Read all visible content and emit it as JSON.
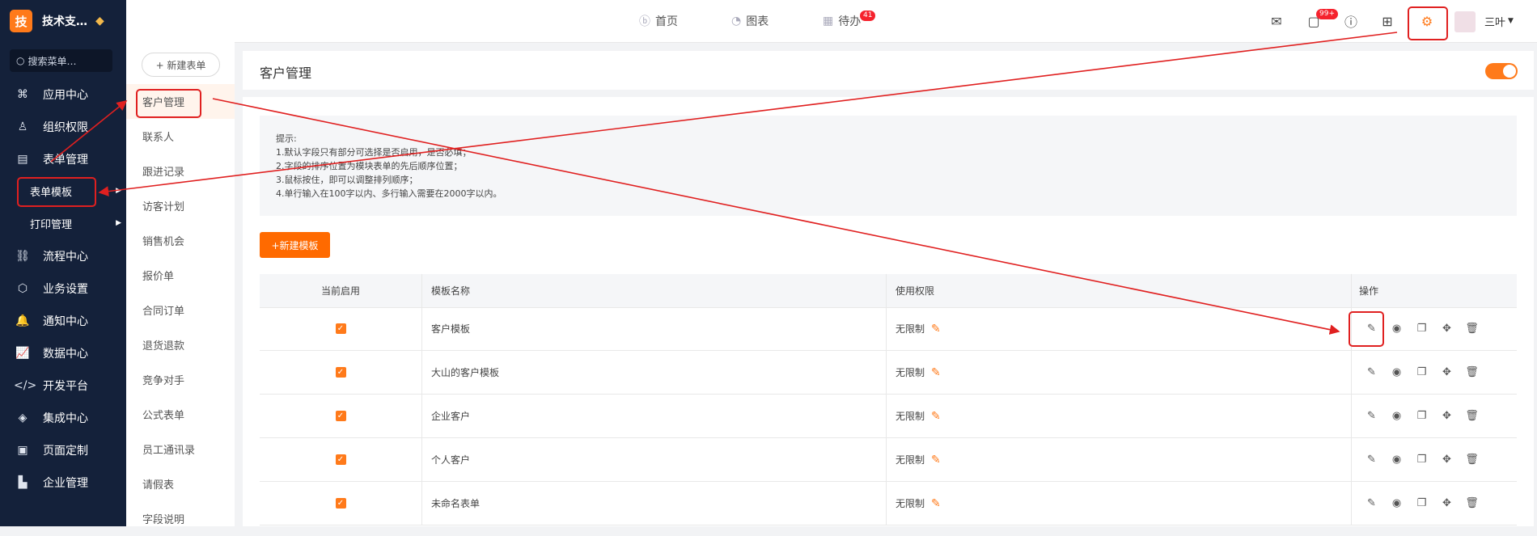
{
  "brand": {
    "logo_char": "技",
    "name": "技术支…"
  },
  "search": {
    "placeholder": "搜索菜单…"
  },
  "sidebar": {
    "items": [
      {
        "label": "应用中心",
        "icon": "apps-icon",
        "glyph": "⌘"
      },
      {
        "label": "组织权限",
        "icon": "user-icon",
        "glyph": "♙"
      },
      {
        "label": "表单管理",
        "icon": "form-icon",
        "glyph": "▤"
      }
    ],
    "subitems": [
      {
        "label": "表单模板"
      },
      {
        "label": "打印管理"
      }
    ],
    "items2": [
      {
        "label": "流程中心",
        "icon": "flow-icon",
        "glyph": "⛓"
      },
      {
        "label": "业务设置",
        "icon": "cube-icon",
        "glyph": "⬡"
      },
      {
        "label": "通知中心",
        "icon": "bell-icon",
        "glyph": "🔔"
      },
      {
        "label": "数据中心",
        "icon": "chart-icon",
        "glyph": "📈"
      },
      {
        "label": "开发平台",
        "icon": "code-icon",
        "glyph": "</>"
      },
      {
        "label": "集成中心",
        "icon": "layers-icon",
        "glyph": "◈"
      },
      {
        "label": "页面定制",
        "icon": "page-icon",
        "glyph": "▣"
      },
      {
        "label": "企业管理",
        "icon": "enterprise-icon",
        "glyph": "▙"
      }
    ]
  },
  "topnav": {
    "home": "首页",
    "charts": "图表",
    "todo": "待办",
    "todo_badge": "41",
    "msg_badge": "99+",
    "user": "三叶"
  },
  "panel2": {
    "new_button": "+ 新建表单",
    "items": [
      "客户管理",
      "联系人",
      "跟进记录",
      "访客计划",
      "销售机会",
      "报价单",
      "合同订单",
      "退货退款",
      "竞争对手",
      "公式表单",
      "员工通讯录",
      "请假表",
      "字段说明"
    ]
  },
  "main": {
    "title": "客户管理",
    "tips": [
      "提示:",
      "1.默认字段只有部分可选择是否启用，是否必填；",
      "2.字段的排序位置为模块表单的先后顺序位置；",
      "3.鼠标按住，即可以调整排列顺序；",
      "4.单行输入在100字以内、多行输入需要在2000字以内。"
    ],
    "new_template": "+新建模板",
    "table": {
      "headers": [
        "当前启用",
        "模板名称",
        "使用权限",
        "操作"
      ],
      "rows": [
        {
          "name": "客户模板",
          "perm": "无限制",
          "enabled": true
        },
        {
          "name": "大山的客户模板",
          "perm": "无限制",
          "enabled": true
        },
        {
          "name": "企业客户",
          "perm": "无限制",
          "enabled": true
        },
        {
          "name": "个人客户",
          "perm": "无限制",
          "enabled": true
        },
        {
          "name": "未命名表单",
          "perm": "无限制",
          "enabled": true
        }
      ]
    }
  },
  "colors": {
    "accent": "#ff7a1a",
    "sidebar": "#14213a",
    "annotation": "#e02020"
  }
}
